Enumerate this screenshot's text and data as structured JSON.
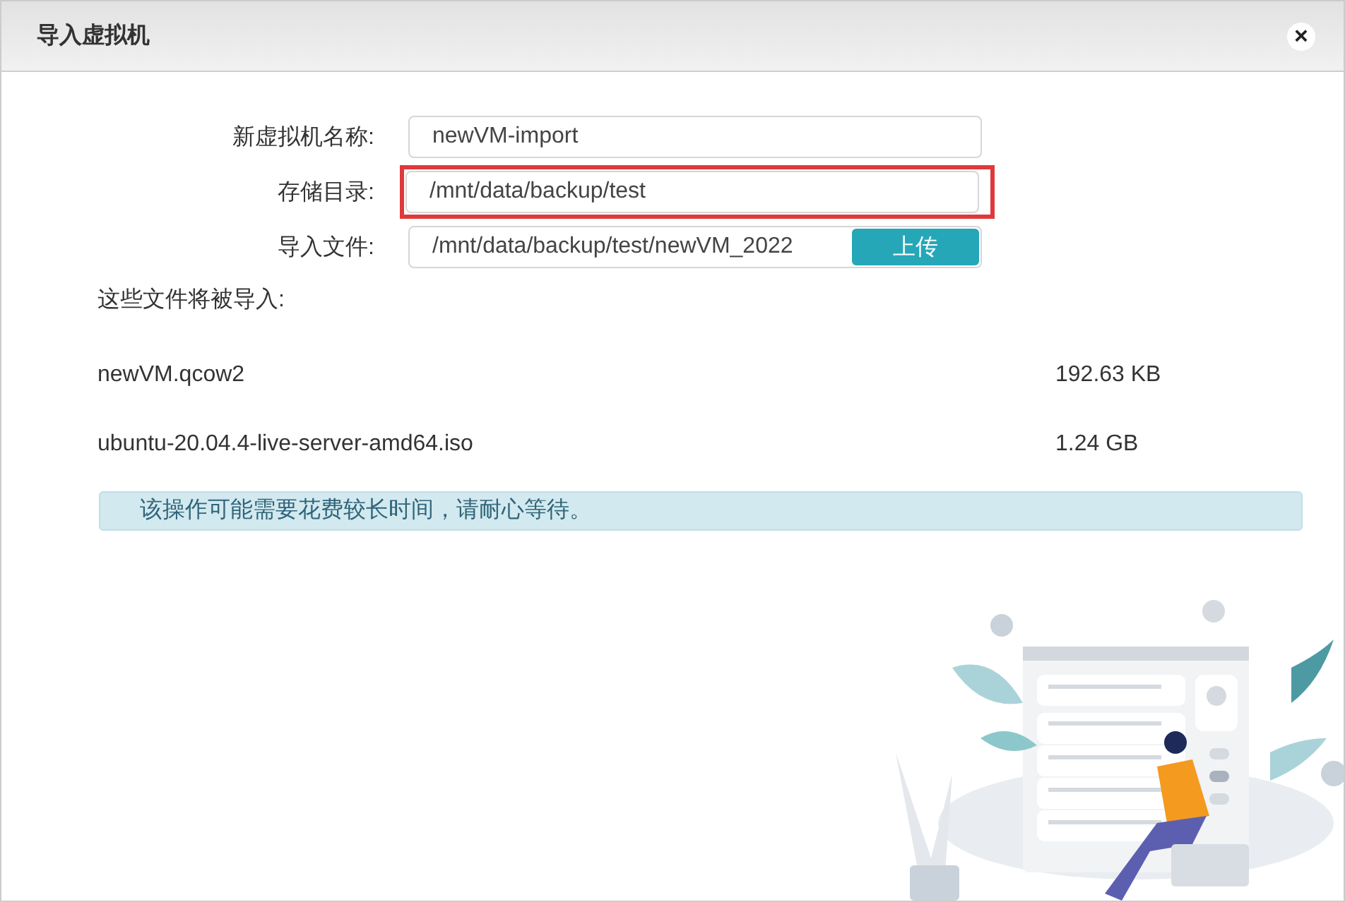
{
  "dialog": {
    "title": "导入虚拟机",
    "close": "×"
  },
  "form": [
    {
      "label": "新虚拟机名称:",
      "value": "newVM-import",
      "highlighted": false,
      "kind": "text"
    },
    {
      "label": "存储目录:",
      "value": "/mnt/data/backup/test",
      "highlighted": true,
      "kind": "text"
    },
    {
      "label": "导入文件:",
      "value": "/mnt/data/backup/test/newVM_2022",
      "highlighted": false,
      "kind": "upload",
      "button": "上传"
    }
  ],
  "files_heading": "这些文件将被导入:",
  "files": [
    {
      "name": "newVM.qcow2",
      "size": "192.63 KB"
    },
    {
      "name": "ubuntu-20.04.4-live-server-amd64.iso",
      "size": "1.24 GB"
    }
  ],
  "notice": "该操作可能需要花费较长时间，请耐心等待。"
}
